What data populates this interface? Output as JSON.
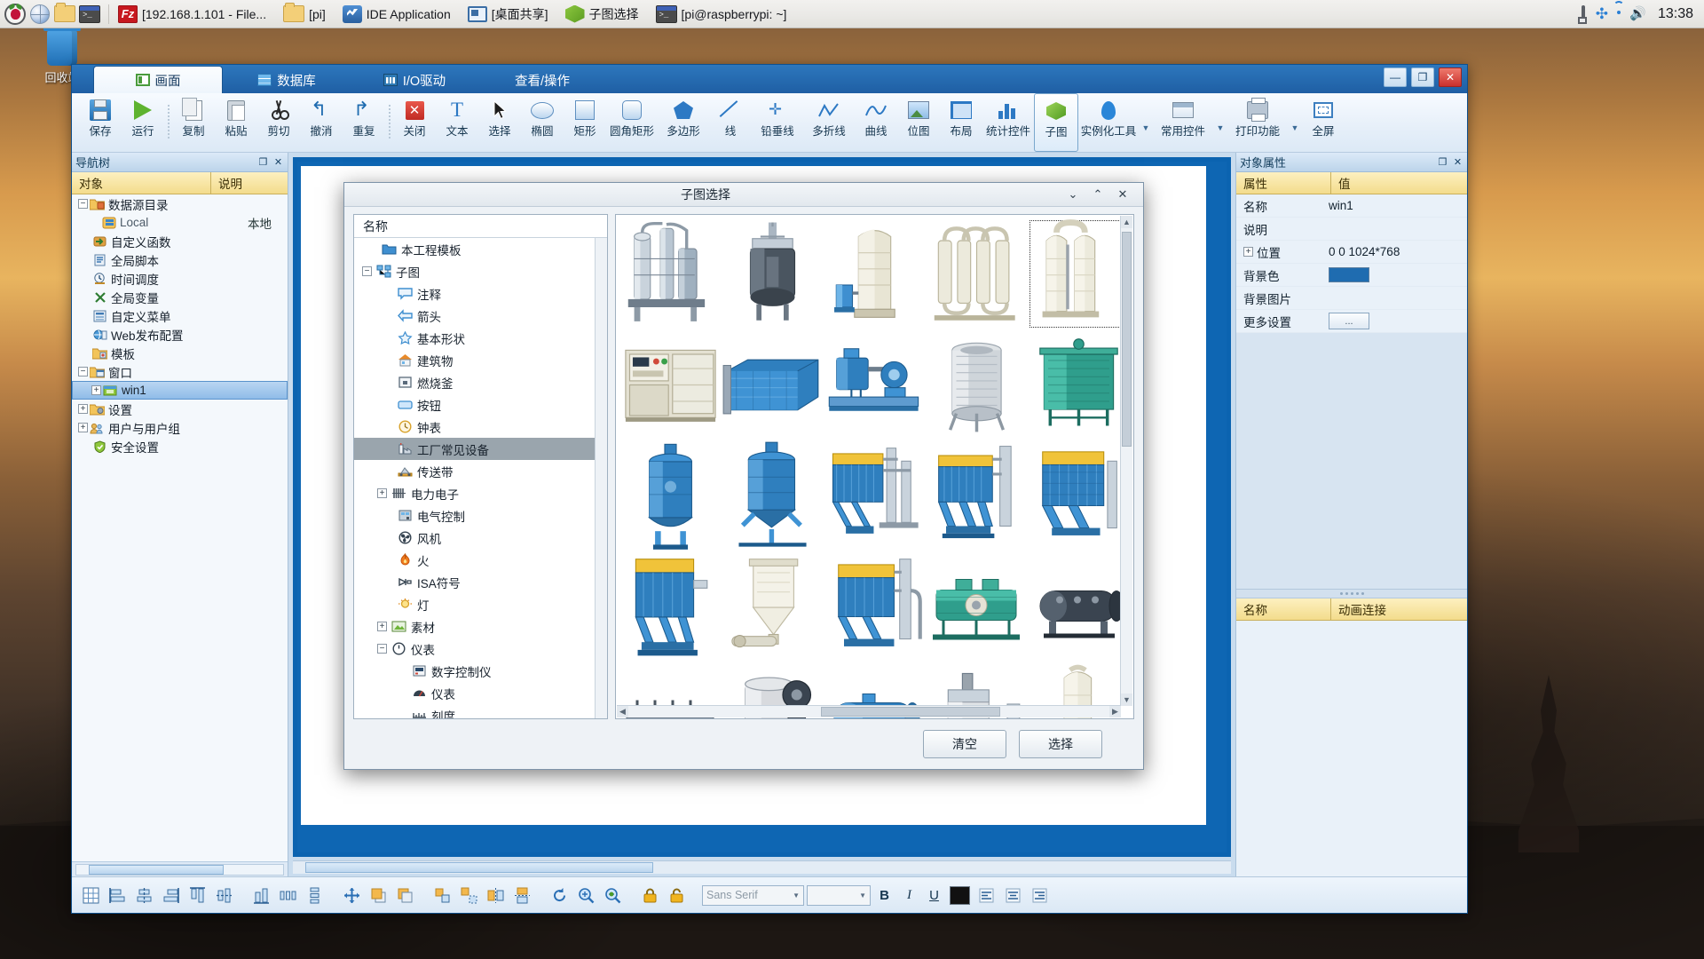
{
  "taskbar": {
    "launchers": [
      {
        "name": "raspberry-menu-icon"
      },
      {
        "name": "browser-icon"
      },
      {
        "name": "file-manager-icon"
      },
      {
        "name": "terminal-icon"
      }
    ],
    "windows": [
      {
        "icon": "filezilla-icon",
        "label": "[192.168.1.101 - File..."
      },
      {
        "icon": "folder-icon",
        "label": "[pi]"
      },
      {
        "icon": "ide-icon",
        "label": "IDE Application"
      },
      {
        "icon": "screen-share-icon",
        "label": "[桌面共享]"
      },
      {
        "icon": "subdiagram-icon",
        "label": "子图选择"
      },
      {
        "icon": "terminal-icon",
        "label": "[pi@raspberrypi: ~]"
      }
    ],
    "tray": [
      {
        "name": "eject-icon"
      },
      {
        "name": "bluetooth-icon"
      },
      {
        "name": "wifi-icon"
      },
      {
        "name": "volume-icon"
      }
    ],
    "clock": "13:38"
  },
  "desktop": {
    "recycle_bin_label": "回收站"
  },
  "app": {
    "tabs": [
      {
        "label": "画面",
        "icon": "screen-icon",
        "active": true
      },
      {
        "label": "数据库",
        "icon": "database-icon",
        "active": false
      },
      {
        "label": "I/O驱动",
        "icon": "io-driver-icon",
        "active": false
      },
      {
        "label": "查看/操作",
        "icon": "",
        "active": false
      }
    ],
    "window_buttons": [
      {
        "name": "minimize-button",
        "glyph": "—"
      },
      {
        "name": "maximize-button",
        "glyph": "❐"
      },
      {
        "name": "close-button",
        "glyph": "✕"
      }
    ],
    "ribbon": [
      {
        "label": "保存",
        "icon": "save-icon"
      },
      {
        "label": "运行",
        "icon": "run-icon"
      },
      {
        "sep": true
      },
      {
        "label": "复制",
        "icon": "copy-icon"
      },
      {
        "label": "粘贴",
        "icon": "paste-icon"
      },
      {
        "label": "剪切",
        "icon": "cut-icon"
      },
      {
        "label": "撤消",
        "icon": "undo-icon"
      },
      {
        "label": "重复",
        "icon": "redo-icon"
      },
      {
        "sep": true
      },
      {
        "label": "关闭",
        "icon": "close-red-icon"
      },
      {
        "label": "文本",
        "icon": "text-icon"
      },
      {
        "label": "选择",
        "icon": "select-arrow-icon"
      },
      {
        "label": "椭圆",
        "icon": "ellipse-icon"
      },
      {
        "label": "矩形",
        "icon": "rectangle-icon"
      },
      {
        "label": "圆角矩形",
        "icon": "rounded-rect-icon"
      },
      {
        "label": "多边形",
        "icon": "polygon-icon"
      },
      {
        "label": "线",
        "icon": "line-icon"
      },
      {
        "label": "铅垂线",
        "icon": "plumb-line-icon"
      },
      {
        "label": "多折线",
        "icon": "polyline-icon"
      },
      {
        "label": "曲线",
        "icon": "curve-icon"
      },
      {
        "label": "位图",
        "icon": "bitmap-icon"
      },
      {
        "label": "布局",
        "icon": "layout-icon"
      },
      {
        "label": "统计控件",
        "icon": "statistics-icon"
      },
      {
        "label": "子图",
        "icon": "subdiagram-icon",
        "boxed": true
      },
      {
        "label": "实例化工具",
        "icon": "instantiate-icon",
        "dropdown": true
      },
      {
        "label": "常用控件",
        "icon": "common-controls-icon",
        "dropdown": true
      },
      {
        "label": "打印功能",
        "icon": "print-icon",
        "dropdown": true
      },
      {
        "label": "全屏",
        "icon": "fullscreen-icon"
      }
    ]
  },
  "nav": {
    "title": "导航树",
    "columns": [
      "对象",
      "说明"
    ],
    "items": [
      {
        "label": "数据源目录",
        "icon": "datasource-folder-icon",
        "indent": 0,
        "expander": "-",
        "desc": ""
      },
      {
        "label": "Local",
        "icon": "local-db-icon",
        "indent": 2,
        "expander": "",
        "desc": "本地"
      },
      {
        "label": "自定义函数",
        "icon": "function-icon",
        "indent": 1,
        "expander": "",
        "desc": ""
      },
      {
        "label": "全局脚本",
        "icon": "script-icon",
        "indent": 1,
        "expander": "",
        "desc": ""
      },
      {
        "label": "时间调度",
        "icon": "scheduler-icon",
        "indent": 1,
        "expander": "",
        "desc": ""
      },
      {
        "label": "全局变量",
        "icon": "variable-icon",
        "indent": 1,
        "expander": "",
        "desc": ""
      },
      {
        "label": "自定义菜单",
        "icon": "menu-icon",
        "indent": 1,
        "expander": "",
        "desc": ""
      },
      {
        "label": "Web发布配置",
        "icon": "web-publish-icon",
        "indent": 1,
        "expander": "",
        "desc": ""
      },
      {
        "label": "模板",
        "icon": "template-folder-icon",
        "indent": 1,
        "expander": "",
        "desc": ""
      },
      {
        "label": "窗口",
        "icon": "window-folder-icon",
        "indent": 0,
        "expander": "-",
        "desc": ""
      },
      {
        "label": "win1",
        "icon": "window-icon",
        "indent": 2,
        "expander": "+",
        "desc": "",
        "selected": true
      },
      {
        "label": "设置",
        "icon": "settings-icon",
        "indent": 0,
        "expander": "+",
        "desc": ""
      },
      {
        "label": "用户与用户组",
        "icon": "users-icon",
        "indent": 0,
        "expander": "+",
        "desc": ""
      },
      {
        "label": "安全设置",
        "icon": "security-icon",
        "indent": 1,
        "expander": "",
        "desc": ""
      }
    ]
  },
  "properties": {
    "title": "对象属性",
    "columns": [
      "属性",
      "值"
    ],
    "rows": [
      {
        "key": "名称",
        "value": "win1",
        "type": "text",
        "expander": ""
      },
      {
        "key": "说明",
        "value": "",
        "type": "text",
        "expander": ""
      },
      {
        "key": "位置",
        "value": "0 0 1024*768",
        "type": "text",
        "expander": "+"
      },
      {
        "key": "背景色",
        "value": "",
        "type": "color",
        "color": "#1f6cb0",
        "expander": ""
      },
      {
        "key": "背景图片",
        "value": "",
        "type": "text",
        "expander": ""
      },
      {
        "key": "更多设置",
        "value": "...",
        "type": "button",
        "expander": ""
      }
    ],
    "animation": {
      "columns": [
        "名称",
        "动画连接"
      ]
    }
  },
  "bottom_toolbar": {
    "buttons": [
      {
        "name": "align-grid-icon"
      },
      {
        "name": "align-left-icon"
      },
      {
        "name": "align-center-h-icon"
      },
      {
        "name": "align-right-icon"
      },
      {
        "name": "align-top-icon"
      },
      {
        "name": "align-middle-icon"
      },
      {
        "name": "align-bottom-icon"
      },
      {
        "name": "distribute-h-icon"
      },
      {
        "name": "distribute-v-icon"
      },
      {
        "name": "same-size-icon"
      },
      {
        "name": "bring-front-icon"
      },
      {
        "name": "send-back-icon"
      },
      {
        "name": "group-icon"
      },
      {
        "name": "ungroup-icon"
      },
      {
        "name": "flip-h-icon"
      },
      {
        "name": "flip-v-icon"
      },
      {
        "name": "rotate-icon"
      },
      {
        "name": "zoom-in-icon"
      },
      {
        "name": "zoom-out-icon"
      },
      {
        "name": "lock-icon"
      },
      {
        "name": "unlock-icon"
      }
    ],
    "font_family": "Sans Serif",
    "font_size": "",
    "text_buttons": [
      {
        "name": "bold-button",
        "label": "B"
      },
      {
        "name": "italic-button",
        "label": "I"
      },
      {
        "name": "underline-button",
        "label": "U"
      }
    ],
    "text_color": "#111111",
    "align_buttons": [
      {
        "name": "text-align-left-icon"
      },
      {
        "name": "text-align-center-icon"
      },
      {
        "name": "text-align-right-icon"
      }
    ]
  },
  "dialog": {
    "title": "子图选择",
    "caption_buttons": [
      {
        "name": "dialog-minimize-button",
        "glyph": "⌄"
      },
      {
        "name": "dialog-restore-button",
        "glyph": "⌃"
      },
      {
        "name": "dialog-close-button",
        "glyph": "✕"
      }
    ],
    "tree_header": "名称",
    "tree_items": [
      {
        "label": "本工程模板",
        "icon": "folder-blue-icon",
        "indent": 1,
        "expander": ""
      },
      {
        "label": "子图",
        "icon": "subdiagram-tree-icon",
        "indent": 0,
        "expander": "-"
      },
      {
        "label": "注释",
        "icon": "comment-icon",
        "indent": 2,
        "expander": ""
      },
      {
        "label": "箭头",
        "icon": "arrow-icon",
        "indent": 2,
        "expander": ""
      },
      {
        "label": "基本形状",
        "icon": "star-icon",
        "indent": 2,
        "expander": ""
      },
      {
        "label": "建筑物",
        "icon": "house-icon",
        "indent": 2,
        "expander": ""
      },
      {
        "label": "燃烧釜",
        "icon": "reactor-icon",
        "indent": 2,
        "expander": ""
      },
      {
        "label": "按钮",
        "icon": "button-icon",
        "indent": 2,
        "expander": ""
      },
      {
        "label": "钟表",
        "icon": "clock-icon",
        "indent": 2,
        "expander": ""
      },
      {
        "label": "工厂常见设备",
        "icon": "factory-icon",
        "indent": 2,
        "expander": "",
        "selected": true
      },
      {
        "label": "传送带",
        "icon": "conveyor-icon",
        "indent": 2,
        "expander": ""
      },
      {
        "label": "电力电子",
        "icon": "power-electronics-icon",
        "indent": 1,
        "expander": "+"
      },
      {
        "label": "电气控制",
        "icon": "electrical-control-icon",
        "indent": 2,
        "expander": ""
      },
      {
        "label": "风机",
        "icon": "fan-icon",
        "indent": 2,
        "expander": ""
      },
      {
        "label": "火",
        "icon": "fire-icon",
        "indent": 2,
        "expander": ""
      },
      {
        "label": "ISA符号",
        "icon": "isa-symbol-icon",
        "indent": 2,
        "expander": ""
      },
      {
        "label": "灯",
        "icon": "lamp-icon",
        "indent": 2,
        "expander": ""
      },
      {
        "label": "素材",
        "icon": "material-icon",
        "indent": 1,
        "expander": "+"
      },
      {
        "label": "仪表",
        "icon": "instrument-icon",
        "indent": 1,
        "expander": "-"
      },
      {
        "label": "数字控制仪",
        "icon": "digital-controller-icon",
        "indent": 3,
        "expander": ""
      },
      {
        "label": "仪表",
        "icon": "gauge-icon",
        "indent": 3,
        "expander": ""
      },
      {
        "label": "刻度",
        "icon": "scale-icon",
        "indent": 3,
        "expander": ""
      }
    ],
    "gallery": [
      {
        "name": "distillation-column-unit",
        "art": "towers-a",
        "selected": false
      },
      {
        "name": "reactor-vessel",
        "art": "reactor",
        "selected": false
      },
      {
        "name": "tall-silo-tank",
        "art": "silo",
        "selected": false
      },
      {
        "name": "heat-exchanger-bank",
        "art": "exchanger",
        "selected": false
      },
      {
        "name": "twin-tower-unit",
        "art": "twin-towers",
        "selected": true
      },
      {
        "name": "control-cabinet",
        "art": "cabinet",
        "selected": false
      },
      {
        "name": "clarifier-basin",
        "art": "basin",
        "selected": false
      },
      {
        "name": "pump-skid",
        "art": "pump-skid",
        "selected": false
      },
      {
        "name": "cooling-tower-round",
        "art": "cooling-round",
        "selected": false
      },
      {
        "name": "cooling-tower-square",
        "art": "cooling-square",
        "selected": false
      },
      {
        "name": "pressure-vessel-a",
        "art": "vessel-a",
        "selected": false
      },
      {
        "name": "pressure-vessel-b",
        "art": "vessel-b",
        "selected": false
      },
      {
        "name": "baghouse-filter-a",
        "art": "baghouse-a",
        "selected": false
      },
      {
        "name": "baghouse-filter-b",
        "art": "baghouse-b",
        "selected": false
      },
      {
        "name": "baghouse-filter-c",
        "art": "baghouse-c",
        "selected": false
      },
      {
        "name": "dust-collector",
        "art": "dust-collector",
        "selected": false
      },
      {
        "name": "hopper-feeder",
        "art": "hopper",
        "selected": false
      },
      {
        "name": "pulse-jet-filter",
        "art": "pulse-filter",
        "selected": false
      },
      {
        "name": "horizontal-mixer",
        "art": "mixer",
        "selected": false
      },
      {
        "name": "horizontal-drum",
        "art": "drum",
        "selected": false
      },
      {
        "name": "vibrating-conveyor",
        "art": "conveyor",
        "selected": false
      },
      {
        "name": "agitator-tank",
        "art": "agitator",
        "selected": false
      },
      {
        "name": "horizontal-tank",
        "art": "h-tank",
        "selected": false
      },
      {
        "name": "mixing-vessel",
        "art": "mixing",
        "selected": false
      },
      {
        "name": "vertical-column",
        "art": "column",
        "selected": false
      }
    ],
    "buttons": [
      {
        "name": "clear-button",
        "label": "清空"
      },
      {
        "name": "select-button",
        "label": "选择"
      }
    ]
  }
}
